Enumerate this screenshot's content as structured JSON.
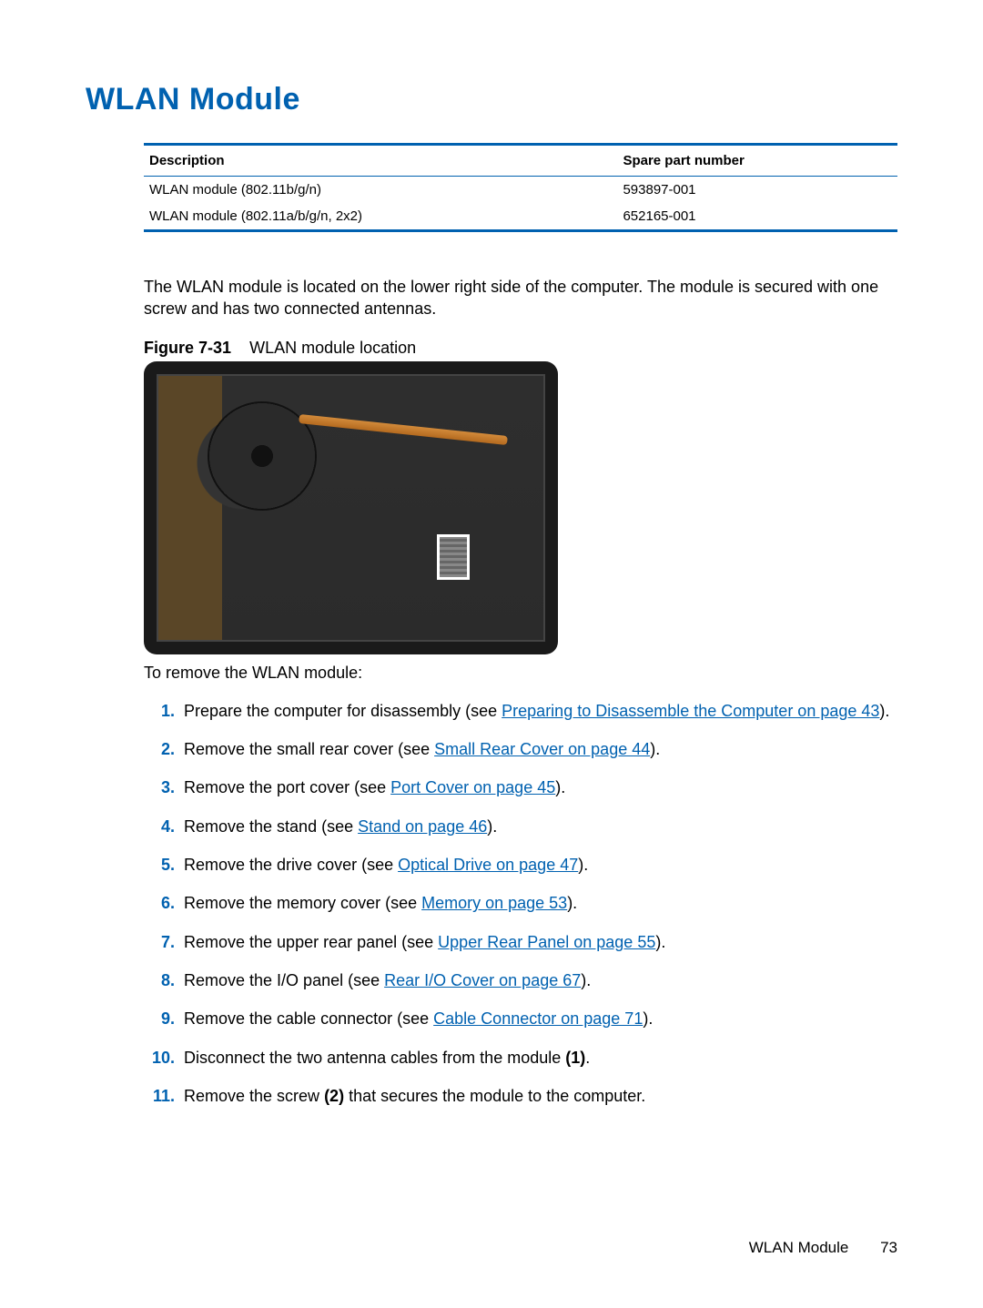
{
  "title": "WLAN Module",
  "table": {
    "headers": {
      "desc": "Description",
      "part": "Spare part number"
    },
    "rows": [
      {
        "desc": "WLAN module (802.11b/g/n)",
        "part": "593897-001"
      },
      {
        "desc": "WLAN module (802.11a/b/g/n, 2x2)",
        "part": "652165-001"
      }
    ]
  },
  "intro": "The WLAN module is located on the lower right side of the computer. The module is secured with one screw and has two connected antennas.",
  "figure": {
    "label": "Figure 7-31",
    "caption": "WLAN module location"
  },
  "preList": "To remove the WLAN module:",
  "steps": [
    {
      "pre": "Prepare the computer for disassembly (see ",
      "link": "Preparing to Disassemble the Computer on page 43",
      "post": ")."
    },
    {
      "pre": "Remove the small rear cover (see ",
      "link": "Small Rear Cover on page 44",
      "post": ")."
    },
    {
      "pre": "Remove the port cover (see ",
      "link": "Port Cover on page 45",
      "post": ")."
    },
    {
      "pre": "Remove the stand (see ",
      "link": "Stand on page 46",
      "post": ")."
    },
    {
      "pre": "Remove the drive cover (see ",
      "link": "Optical Drive on page 47",
      "post": ")."
    },
    {
      "pre": "Remove the memory cover (see ",
      "link": "Memory on page 53",
      "post": ")."
    },
    {
      "pre": "Remove the upper rear panel (see ",
      "link": "Upper Rear Panel on page 55",
      "post": ")."
    },
    {
      "pre": "Remove the I/O panel (see ",
      "link": "Rear I/O Cover on page 67",
      "post": ")."
    },
    {
      "pre": "Remove the cable connector (see ",
      "link": "Cable Connector on page 71",
      "post": ")."
    },
    {
      "pre": "Disconnect the two antenna cables from the module ",
      "bold": "(1)",
      "post": "."
    },
    {
      "pre": "Remove the screw ",
      "bold": "(2)",
      "post": " that secures the module to the computer."
    }
  ],
  "footer": {
    "section": "WLAN Module",
    "page": "73"
  }
}
